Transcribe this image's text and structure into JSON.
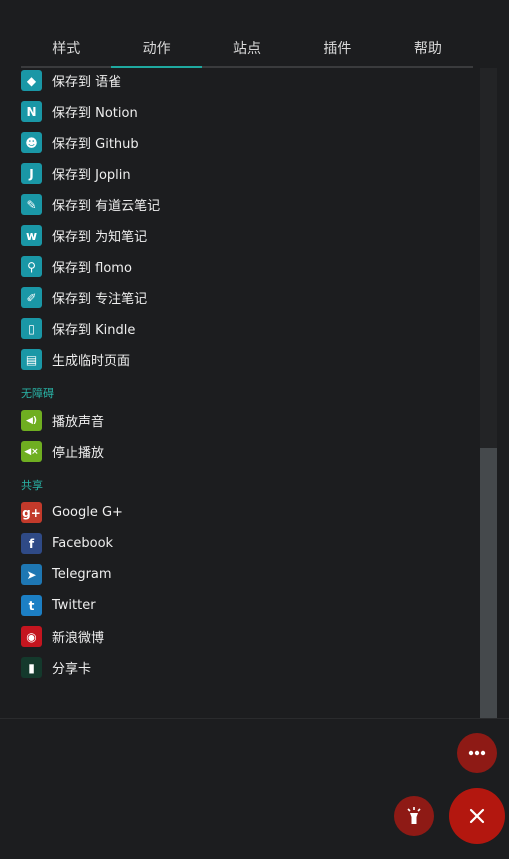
{
  "tabs": [
    "样式",
    "动作",
    "站点",
    "插件",
    "帮助"
  ],
  "active_tab": 1,
  "save_items": [
    {
      "label": "保存到 语雀",
      "icon": "yuque-icon",
      "glyph": "◆"
    },
    {
      "label": "保存到 Notion",
      "icon": "notion-icon",
      "glyph": "N"
    },
    {
      "label": "保存到 Github",
      "icon": "github-icon",
      "glyph": "☻"
    },
    {
      "label": "保存到 Joplin",
      "icon": "joplin-icon",
      "glyph": "J"
    },
    {
      "label": "保存到 有道云笔记",
      "icon": "youdao-icon",
      "glyph": "✎"
    },
    {
      "label": "保存到 为知笔记",
      "icon": "wiz-icon",
      "glyph": "w"
    },
    {
      "label": "保存到 flomo",
      "icon": "flomo-icon",
      "glyph": "⚲"
    },
    {
      "label": "保存到 专注笔记",
      "icon": "focus-note-icon",
      "glyph": "✐"
    },
    {
      "label": "保存到 Kindle",
      "icon": "kindle-icon",
      "glyph": "▯"
    },
    {
      "label": "生成临时页面",
      "icon": "temp-page-icon",
      "glyph": "▤"
    }
  ],
  "sections": {
    "accessibility": "无障碍",
    "share": "共享"
  },
  "accessibility_items": [
    {
      "label": "播放声音",
      "icon": "speaker-play-icon",
      "glyph": "◀)"
    },
    {
      "label": "停止播放",
      "icon": "speaker-stop-icon",
      "glyph": "◀×"
    }
  ],
  "share_items": [
    {
      "label": "Google G+",
      "icon": "google-plus-icon",
      "glyph": "g+",
      "color": "#c23a2b"
    },
    {
      "label": "Facebook",
      "icon": "facebook-icon",
      "glyph": "f",
      "color": "#2f4a86"
    },
    {
      "label": "Telegram",
      "icon": "telegram-icon",
      "glyph": "➤",
      "color": "#1e77b3"
    },
    {
      "label": "Twitter",
      "icon": "twitter-icon",
      "glyph": "t",
      "color": "#1c7fc4"
    },
    {
      "label": "新浪微博",
      "icon": "weibo-icon",
      "glyph": "◉",
      "color": "#c4151f"
    },
    {
      "label": "分享卡",
      "icon": "share-card-icon",
      "glyph": "▮",
      "color": "#14392c"
    }
  ],
  "colors": {
    "accent": "#1fa9a0",
    "teal_icon": "#1a97a6",
    "green_icon": "#6fae21",
    "fab": "#b3170f"
  }
}
